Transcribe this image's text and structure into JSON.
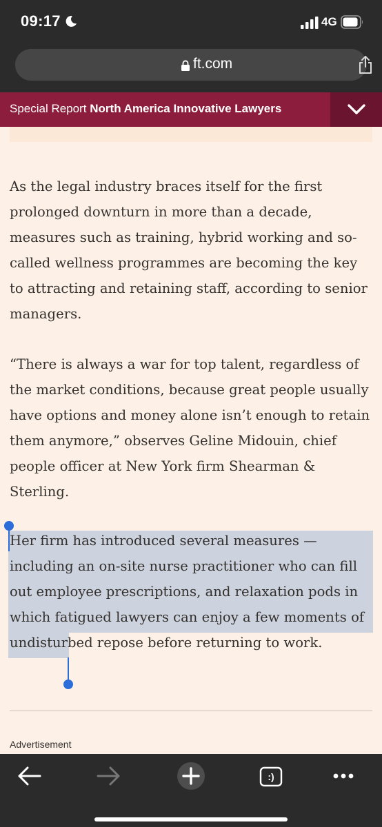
{
  "status_bar": {
    "time": "09:17",
    "network": "4G",
    "icons": [
      "moon-icon",
      "signal-icon",
      "battery-icon"
    ]
  },
  "browser": {
    "url": "ft.com",
    "icons": [
      "lock-icon",
      "share-icon"
    ]
  },
  "report_banner": {
    "prefix": "Special Report",
    "title": "North America Innovative Lawyers",
    "toggle_icon": "chevron-down-icon",
    "background": "#8c1d3c"
  },
  "article": {
    "background": "#fdf1e7",
    "paragraphs": [
      "As the legal industry braces itself for the first prolonged downturn in more than a decade, measures such as training, hybrid working and so-called wellness programmes are becoming the key to attracting and retaining staff, according to senior managers.",
      "“There is always a war for top talent, regardless of the market conditions, because great people usually have options and money alone isn’t enough to retain them anymore,” observes Geline Midouin, chief people officer at New York firm Shearman & Sterling.",
      "Her firm has introduced several measures — including an on-site nurse practitioner who can fill out employee prescriptions, and relaxation pods in which fatigued lawyers can enjoy a few moments of undisturbed repose before returning to work."
    ],
    "selected_paragraph_index": 2,
    "selection_color": "#cdd3de",
    "advertisement_label": "Advertisement"
  },
  "toolbar": {
    "items": [
      "back-arrow-icon",
      "forward-arrow-icon",
      "new-tab-plus-icon",
      "tabs-icon",
      "more-menu-icon"
    ],
    "tabs_count": ":)"
  }
}
